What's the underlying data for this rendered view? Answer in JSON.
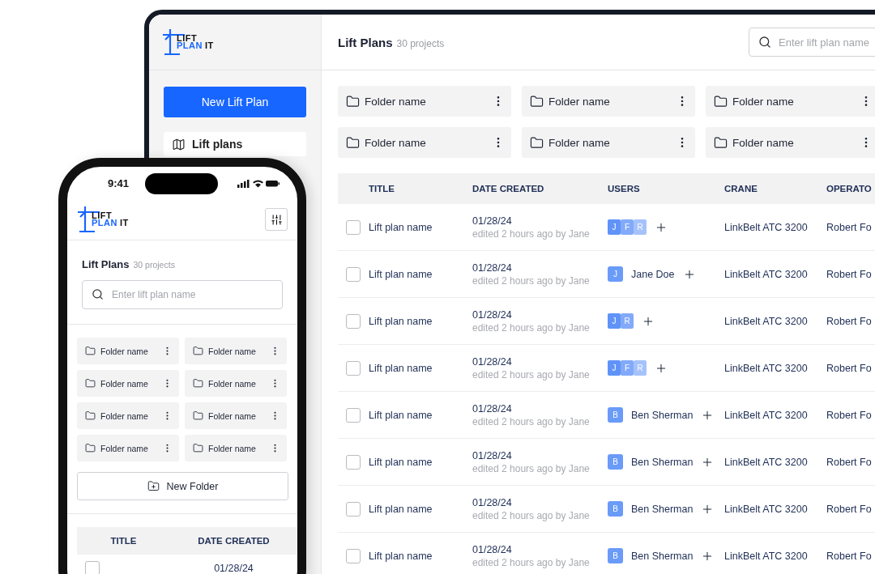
{
  "desktop": {
    "logo": {
      "word_1": "LIFT",
      "word_2": "PLAN",
      "word_3": "IT"
    },
    "sidebar": {
      "new_button": "New Lift Plan",
      "items": [
        {
          "label": "Lift plans",
          "selected": true
        }
      ]
    },
    "header": {
      "title": "Lift Plans",
      "count": "30 projects",
      "search_placeholder": "Enter lift plan name"
    },
    "folders": [
      "Folder name",
      "Folder name",
      "Folder name",
      "Folder name",
      "Folder name",
      "Folder name"
    ],
    "table": {
      "columns": [
        "TITLE",
        "DATE CREATED",
        "USERS",
        "CRANE",
        "OPERATO"
      ],
      "rows": [
        {
          "checked": false,
          "title": "Lift plan name",
          "date": "01/28/24",
          "edited": "edited 2 hours ago by Jane",
          "users": {
            "kind": "stack",
            "initials": [
              "J",
              "F",
              "R"
            ]
          },
          "crane": "LinkBelt ATC 3200",
          "operator": "Robert Fo"
        },
        {
          "checked": false,
          "title": "Lift plan name",
          "date": "01/28/24",
          "edited": "edited 2 hours ago by Jane",
          "users": {
            "kind": "person",
            "initial": "J",
            "name": "Jane Doe"
          },
          "crane": "LinkBelt ATC 3200",
          "operator": "Robert Fo"
        },
        {
          "checked": false,
          "title": "Lift plan name",
          "date": "01/28/24",
          "edited": "edited 2 hours ago by Jane",
          "users": {
            "kind": "stack",
            "initials": [
              "J",
              "R"
            ]
          },
          "crane": "LinkBelt ATC 3200",
          "operator": "Robert Fo"
        },
        {
          "checked": false,
          "title": "Lift plan name",
          "date": "01/28/24",
          "edited": "edited 2 hours ago by Jane",
          "users": {
            "kind": "stack",
            "initials": [
              "J",
              "F",
              "R"
            ]
          },
          "crane": "LinkBelt ATC 3200",
          "operator": "Robert Fo"
        },
        {
          "checked": false,
          "title": "Lift plan name",
          "date": "01/28/24",
          "edited": "edited 2 hours ago by Jane",
          "users": {
            "kind": "person",
            "initial": "B",
            "name": "Ben Sherman"
          },
          "crane": "LinkBelt ATC 3200",
          "operator": "Robert Fo"
        },
        {
          "checked": false,
          "title": "Lift plan name",
          "date": "01/28/24",
          "edited": "edited 2 hours ago by Jane",
          "users": {
            "kind": "person",
            "initial": "B",
            "name": "Ben Sherman"
          },
          "crane": "LinkBelt ATC 3200",
          "operator": "Robert Fo"
        },
        {
          "checked": false,
          "title": "Lift plan name",
          "date": "01/28/24",
          "edited": "edited 2 hours ago by Jane",
          "users": {
            "kind": "person",
            "initial": "B",
            "name": "Ben Sherman"
          },
          "crane": "LinkBelt ATC 3200",
          "operator": "Robert Fo"
        },
        {
          "checked": false,
          "title": "Lift plan name",
          "date": "01/28/24",
          "edited": "edited 2 hours ago by Jane",
          "users": {
            "kind": "person",
            "initial": "B",
            "name": "Ben Sherman"
          },
          "crane": "LinkBelt ATC 3200",
          "operator": "Robert Fo"
        }
      ]
    }
  },
  "phone": {
    "status_time": "9:41",
    "logo": {
      "word_1": "LIFT",
      "word_2": "PLAN",
      "word_3": "IT"
    },
    "header": {
      "title": "Lift Plans",
      "count": "30 projects",
      "search_placeholder": "Enter lift plan name"
    },
    "folders": [
      "Folder name",
      "Folder name",
      "Folder name",
      "Folder name",
      "Folder name",
      "Folder name",
      "Folder name",
      "Folder name"
    ],
    "new_folder": "New Folder",
    "table": {
      "columns": [
        "TITLE",
        "DATE CREATED"
      ],
      "rows": [
        {
          "checked": false,
          "date": "01/28/24"
        }
      ]
    }
  }
}
